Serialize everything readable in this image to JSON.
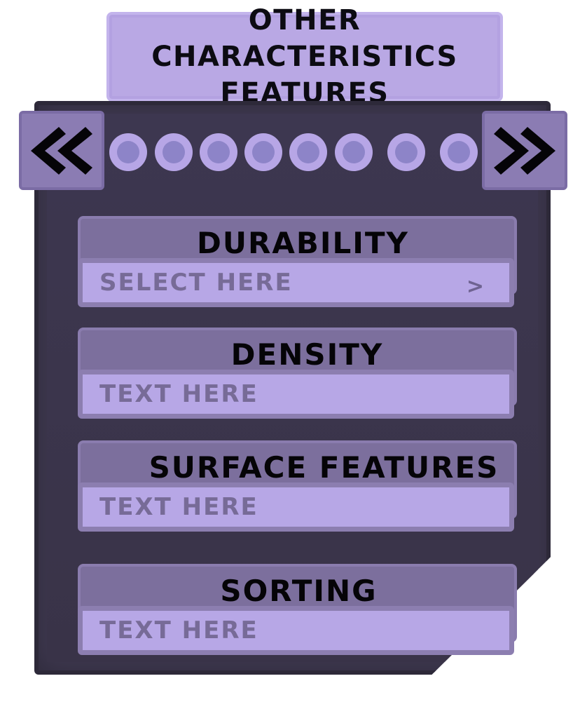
{
  "header": {
    "title_line1": "OTHER CHARACTERISTICS",
    "title_line2": "FEATURES"
  },
  "nav": {
    "prev_icon": "double-chevron-left-icon",
    "next_icon": "double-chevron-right-icon",
    "page_dots": 8
  },
  "fields": [
    {
      "label": "DURABILITY",
      "value": "SELECT HERE",
      "type": "select",
      "chevron": ">"
    },
    {
      "label": "DENSITY",
      "value": "TEXT HERE",
      "type": "text"
    },
    {
      "label": "SURFACE FEATURES",
      "value": "TEXT HERE",
      "type": "text"
    },
    {
      "label": "SORTING",
      "value": "TEXT HERE",
      "type": "text"
    }
  ],
  "colors": {
    "panel": "#3f3950",
    "accent": "#b7a6e6",
    "header": "#7c6f9d"
  }
}
